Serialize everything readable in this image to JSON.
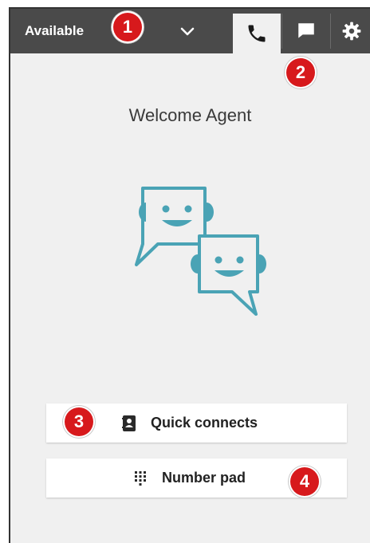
{
  "status": {
    "label": "Available",
    "dropdown_icon": "chevron-down-icon"
  },
  "tabs": [
    {
      "icon": "phone-icon",
      "active": true
    },
    {
      "icon": "chat-icon",
      "active": false
    },
    {
      "icon": "gear-icon",
      "active": false
    }
  ],
  "welcome": "Welcome Agent",
  "illustration_icon": "chat-bots-icon",
  "actions": {
    "quick_connects": {
      "label": "Quick connects",
      "icon": "contact-book-icon"
    },
    "number_pad": {
      "label": "Number pad",
      "icon": "dialpad-icon"
    }
  },
  "callouts": [
    "1",
    "2",
    "3",
    "4"
  ],
  "colors": {
    "topbar": "#4a4a4a",
    "panel": "#f0f0f0",
    "illustration": "#4aa3b5",
    "callout": "#d7191c"
  }
}
